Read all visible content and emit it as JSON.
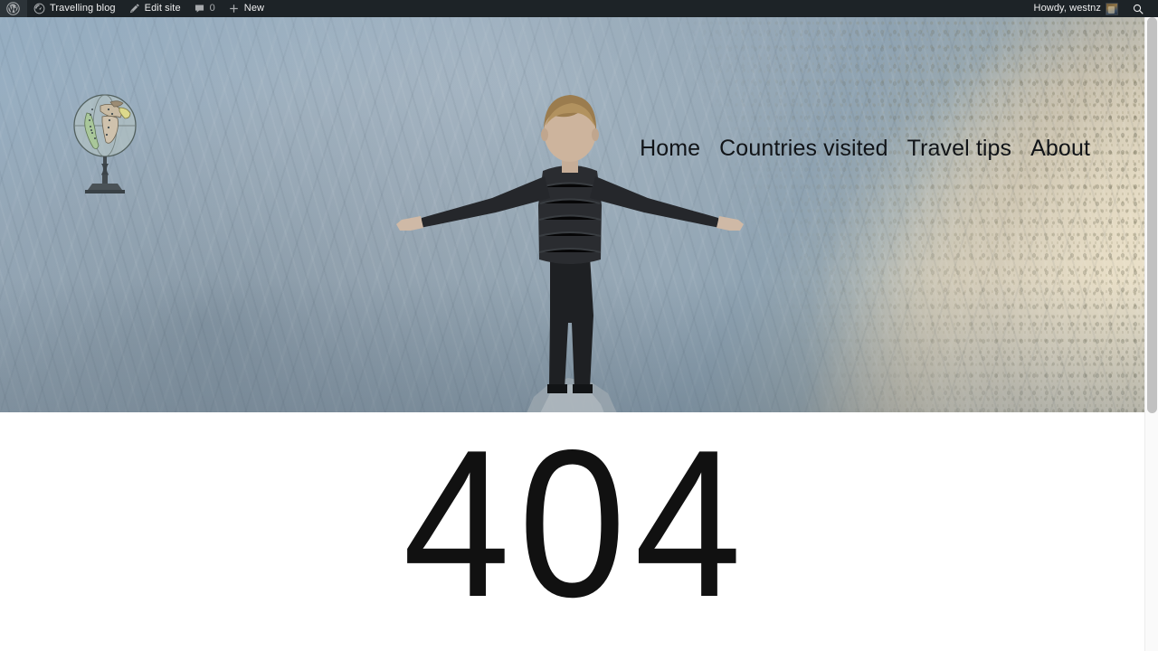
{
  "admin_bar": {
    "wp_logo_icon": "wordpress-logo-icon",
    "items": [
      {
        "icon": "dashboard-site-icon",
        "label": "Travelling blog"
      },
      {
        "icon": "pencil-edit-icon",
        "label": "Edit site"
      },
      {
        "icon": "comment-bubble-icon",
        "label": "",
        "count": "0"
      },
      {
        "icon": "plus-icon",
        "label": "New"
      }
    ],
    "howdy": "Howdy, westnz",
    "avatar_icon": "user-avatar",
    "search_icon": "search-icon",
    "background_color": "#1d2327",
    "text_color": "#f0f0f1"
  },
  "site": {
    "logo_icon": "vintage-globe-logo",
    "nav": [
      {
        "label": "Home"
      },
      {
        "label": "Countries visited"
      },
      {
        "label": "Travel tips"
      },
      {
        "label": "About"
      }
    ],
    "nav_text_color": "#111418"
  },
  "hero": {
    "image_alt": "Man standing on a cliff edge with arms outstretched facing a granite valley wall",
    "figure_icon": "person-arms-outstretched"
  },
  "content": {
    "error_code": "404",
    "background_color": "#ffffff",
    "text_color": "#111111"
  },
  "scrollbar": {
    "track_color": "#fafafa",
    "thumb_color": "#c1c1c1"
  }
}
